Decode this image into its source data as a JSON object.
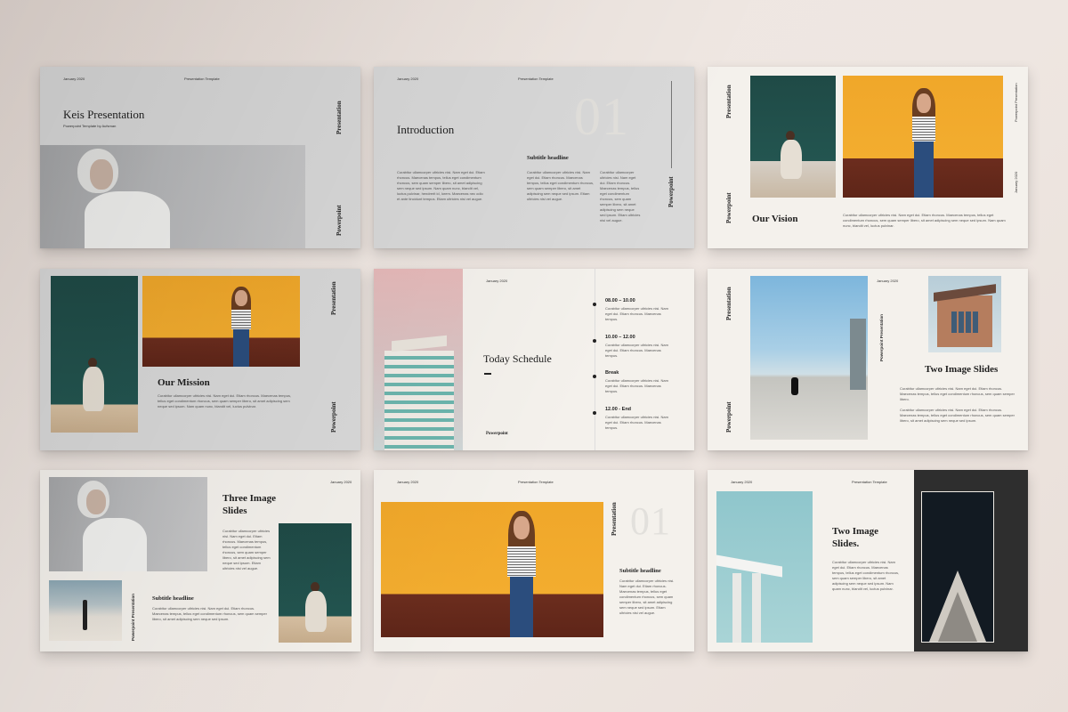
{
  "slide1": {
    "date": "January 2020",
    "label": "Presentation Template",
    "title": "Keis Presentation",
    "subtitle": "Powerpoint Template by Aufsman",
    "vert_top": "Presentation",
    "vert_bottom": "Powerpoint"
  },
  "slide2": {
    "date": "January 2020",
    "label": "Presentation Template",
    "number": "01",
    "title": "Introduction",
    "subtitle_headline": "Subtitle headline",
    "body_left": "Curabitur ullamcorper ultricies nisi. Nam eget dui. Etiam rhoncus. Maecenas tempus, tellus eget condimentum rhoncus, sem quam semper libero, sit amet adipiscing sem neque sed ipsum. Nam quam nunc, blandit vel, luctus pulvinar, hendrerit id, lorem. Maecenas nec odio et ante tincidunt tempus. Etiam ultricies nisi vel augue.",
    "body_mid": "Curabitur ullamcorper ultricies nisi. Nam eget dui. Etiam rhoncus. Maecenas tempus, tellus eget condimentum rhoncus, sem quam semper libero, sit amet adipiscing sem neque sed ipsum. Etiam ultricies nisi vel augue.",
    "body_right": "Curabitur ullamcorper ultricies nisi. Nam eget dui. Etiam rhoncus. Maecenas tempus, tellus eget condimentum rhoncus, sem quam semper libero, sit amet adipiscing sem neque sed ipsum. Etiam ultricies nisi vel augue.",
    "vert": "Powerpoint"
  },
  "slide3": {
    "vert_top": "Presentation",
    "vert_bottom": "Powerpoint",
    "right_label": "Powerpoint Presentation",
    "date": "January 2020",
    "title": "Our Vision",
    "body": "Curabitur ullamcorper ultricies nisi. Nam eget dui. Etiam rhoncus. Maecenas tempus, tellus eget condimentum rhoncus, sem quam semper libero, sit amet adipiscing sem neque sed ipsum. Nam quam nunc, blandit vel, luctus pulvinar."
  },
  "slide4": {
    "title": "Our Mission",
    "body": "Curabitur ullamcorper ultricies nisi. Nam eget dui. Etiam rhoncus. Maecenas tempus, tellus eget condimentum rhoncus, sem quam semper libero, sit amet adipiscing sem neque sed ipsum. Nam quam nunc, blandit vel, luctus pulvinar.",
    "vert_top": "Presentation",
    "vert_bottom": "Powerpoint"
  },
  "slide5": {
    "date": "January 2020",
    "title": "Today Schedule",
    "brand": "Powerpoint",
    "items": [
      {
        "time": "08.00 – 10.00",
        "text": "Curabitur ullamcorper ultricies nisi. Nam eget dui. Etiam rhoncus. Maecenas tempus."
      },
      {
        "time": "10.00 – 12.00",
        "text": "Curabitur ullamcorper ultricies nisi. Nam eget dui. Etiam rhoncus. Maecenas tempus."
      },
      {
        "time": "Break",
        "text": "Curabitur ullamcorper ultricies nisi. Nam eget dui. Etiam rhoncus. Maecenas tempus."
      },
      {
        "time": "12.00 - End",
        "text": "Curabitur ullamcorper ultricies nisi. Nam eget dui. Etiam rhoncus. Maecenas tempus."
      }
    ]
  },
  "slide6": {
    "date": "January 2020",
    "vert_top": "Presentation",
    "vert_mid": "Powerpoint Presentation",
    "vert_bottom": "Powerpoint",
    "title": "Two Image Slides",
    "body1": "Curabitur ullamcorper ultricies nisi. Nam eget dui. Etiam rhoncus. Maecenas tempus, tellus eget condimentum rhoncus, sem quam semper libero.",
    "body2": "Curabitur ullamcorper ultricies nisi. Nam eget dui. Etiam rhoncus. Maecenas tempus, tellus eget condimentum rhoncus, sem quam semper libero, sit amet adipiscing sem neque sed ipsum."
  },
  "slide7": {
    "date": "January 2020",
    "title_line1": "Three Image",
    "title_line2": "Slides",
    "body": "Curabitur ullamcorper ultricies nisi. Nam eget dui. Etiam rhoncus. Maecenas tempus, tellus eget condimentum rhoncus, sem quam semper libero, sit amet adipiscing sem neque sed ipsum. Etiam ultricies nisi vel augue.",
    "subtitle_headline": "Subtitle headline",
    "sub_body": "Curabitur ullamcorper ultricies nisi. Nam eget dui. Etiam rhoncus. Maecenas tempus, tellus eget condimentum rhoncus, sem quam semper libero, sit amet adipiscing sem neque sed ipsum.",
    "vert": "Powerpoint Presentation"
  },
  "slide8": {
    "date": "January 2020",
    "label": "Presentation Template",
    "vert": "Presentation",
    "number": "01",
    "subtitle_headline": "Subtitle headline",
    "body": "Curabitur ullamcorper ultricies nisi. Nam eget dui. Etiam rhoncus. Maecenas tempus, tellus eget condimentum rhoncus, sem quam semper libero, sit amet adipiscing sem neque sed ipsum. Etiam ultricies nisi vel augue."
  },
  "slide9": {
    "date": "January 2020",
    "label": "Presentation Template",
    "title_line1": "Two Image",
    "title_line2": "Slides.",
    "body": "Curabitur ullamcorper ultricies nisi. Nam eget dui. Etiam rhoncus. Maecenas tempus, tellus eget condimentum rhoncus, sem quam semper libero, sit amet adipiscing sem neque sed ipsum. Nam quam nunc, blandit vel, luctus pulvinar."
  }
}
